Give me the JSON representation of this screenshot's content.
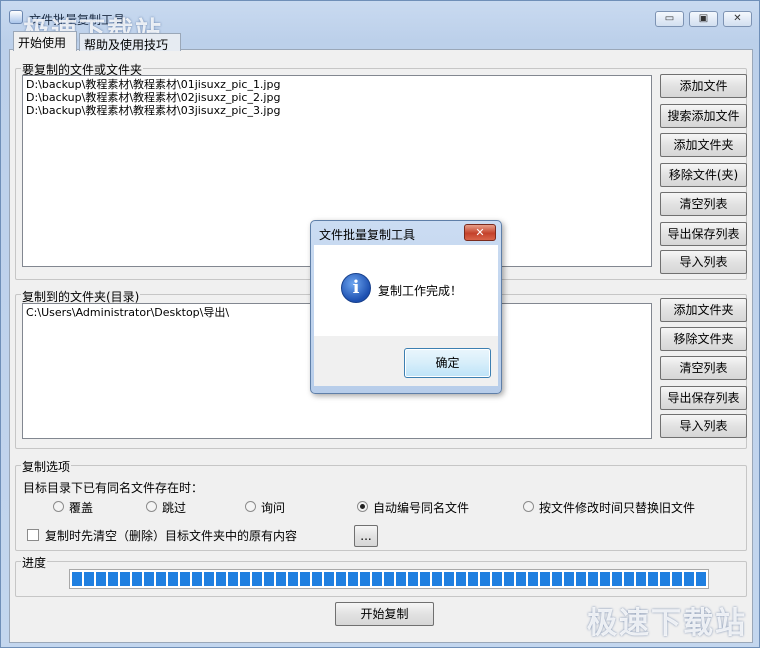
{
  "window": {
    "title": "文件批量复制工具",
    "minimize": "▭",
    "maximize": "▣",
    "close": "✕"
  },
  "watermark": "极速下载站",
  "tabs": [
    "开始使用",
    "帮助及使用技巧"
  ],
  "source_group": {
    "label": "要复制的文件或文件夹",
    "items": [
      "D:\\backup\\教程素材\\教程素材\\01jisuxz_pic_1.jpg",
      "D:\\backup\\教程素材\\教程素材\\02jisuxz_pic_2.jpg",
      "D:\\backup\\教程素材\\教程素材\\03jisuxz_pic_3.jpg"
    ],
    "buttons": [
      "添加文件",
      "搜索添加文件",
      "添加文件夹",
      "移除文件(夹)",
      "清空列表",
      "导出保存列表",
      "导入列表"
    ]
  },
  "dest_group": {
    "label": "复制到的文件夹(目录)",
    "items": [
      "C:\\Users\\Administrator\\Desktop\\导出\\"
    ],
    "buttons": [
      "添加文件夹",
      "移除文件夹",
      "清空列表",
      "导出保存列表",
      "导入列表"
    ]
  },
  "options": {
    "label": "复制选项",
    "question": "目标目录下已有同名文件存在时：",
    "radios": [
      "覆盖",
      "跳过",
      "询问",
      "自动编号同名文件",
      "按文件修改时间只替换旧文件"
    ],
    "selected_radio": "自动编号同名文件",
    "clear_checkbox": "复制时先清空（删除）目标文件夹中的原有内容",
    "clear_checked": false,
    "browse": "..."
  },
  "progress": {
    "label": "进度",
    "fraction": 1.0
  },
  "start_button": "开始复制",
  "dialog": {
    "title": "文件批量复制工具",
    "close": "✕",
    "message": "复制工作完成！",
    "ok": "确定"
  }
}
